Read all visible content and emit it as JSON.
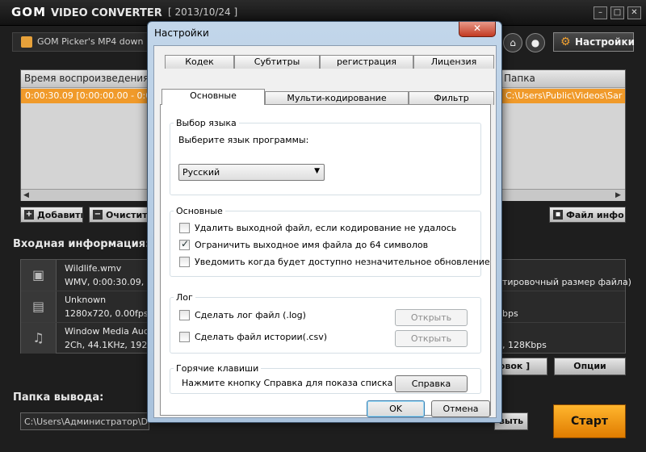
{
  "app": {
    "logo_brand": "GOM",
    "logo_product": "VIDEO CONVERTER",
    "build_date": "[ 2013/10/24 ]",
    "window_buttons": {
      "minimize": "–",
      "maximize": "□",
      "close": "✕"
    },
    "picker_text": "GOM Picker's MP4 down",
    "settings_label": "Настройки",
    "list": {
      "columns": {
        "time": "Время воспроизведения",
        "folder": "Папка"
      },
      "rows": [
        {
          "time": "0:00:30.09 [0:00:00.00 - 0:0",
          "folder": "C:\\Users\\Public\\Videos\\Sar"
        }
      ],
      "scroll_left": "◀",
      "scroll_right": "▶"
    },
    "buttons": {
      "add": "Добавить",
      "clear": "Очистить",
      "file_info": "Файл инфо",
      "settings_short": "овок ]",
      "options": "Опции",
      "browse": "выть",
      "start": "Старт"
    },
    "input_info_title": "Входная информация:",
    "input_info": [
      {
        "line1": "Wildlife.wmv",
        "line2": "WMV, 0:00:30.09, 25",
        "right": "тировочный размер файла)"
      },
      {
        "line1": "Unknown",
        "line2": "1280x720, 0.00fps, 0",
        "right": "bps"
      },
      {
        "line1": "Window Media Audio",
        "line2": "2Ch, 44.1KHz, 192Ki",
        "right": ", 128Kbps"
      }
    ],
    "output_folder_title": "Папка вывода:",
    "output_path": "C:\\Users\\Администратор\\Docu"
  },
  "dialog": {
    "title": "Настройки",
    "close": "✕",
    "tabs_row1": [
      "Кодек",
      "Субтитры",
      "регистрация",
      "Лицензия"
    ],
    "tabs_row2": [
      "Основные",
      "Мульти-кодирование",
      "Фильтр"
    ],
    "language_group": {
      "label": "Выбор языка",
      "prompt": "Выберите язык программы:",
      "selected": "Русский"
    },
    "general_group": {
      "label": "Основные",
      "options": [
        {
          "label": "Удалить выходной файл, если кодирование не удалось",
          "checked": false
        },
        {
          "label": "Ограничить выходное имя файла до 64 символов",
          "checked": true
        },
        {
          "label": "Уведомить когда будет доступно незначительное обновление",
          "checked": false
        }
      ]
    },
    "log_group": {
      "label": "Лог",
      "options": [
        {
          "label": "Сделать лог файл (.log)",
          "button": "Открыть"
        },
        {
          "label": "Сделать файл истории(.csv)",
          "button": "Открыть"
        }
      ]
    },
    "hotkeys_group": {
      "label": "Горячие клавиши",
      "text": "Нажмите кнопку Справка для показа списка",
      "button": "Справка"
    },
    "ok": "OK",
    "cancel": "Отмена"
  }
}
